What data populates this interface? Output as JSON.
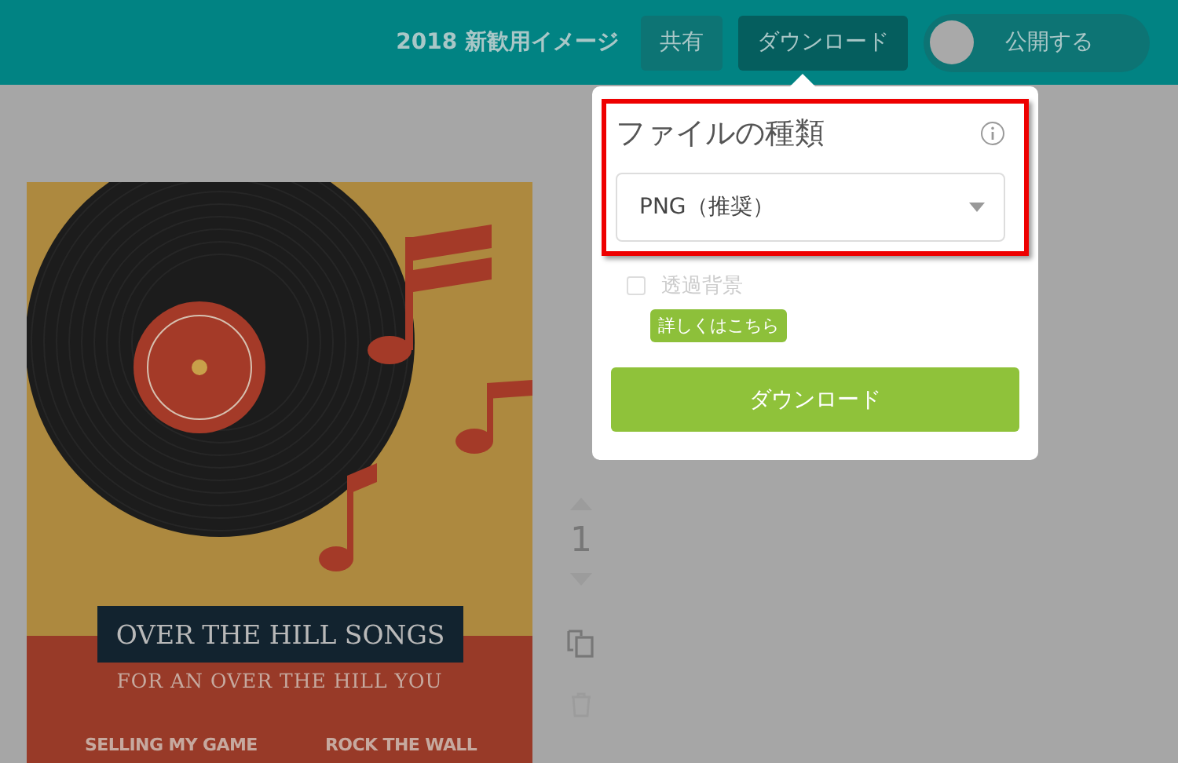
{
  "header": {
    "title": "2018 新歓用イメージ",
    "buttons": [
      {
        "label": "共有",
        "selected": false
      },
      {
        "label": "ダウンロード",
        "selected": true
      }
    ],
    "publish_toggle": {
      "label": "公開する",
      "on": false
    }
  },
  "download_panel": {
    "heading": "ファイルの種類",
    "highlighted": true,
    "file_type": {
      "value": "PNG（推奨）"
    },
    "transparent_background": {
      "label": "透過背景",
      "checked": false,
      "disabled": true
    },
    "help_badge": "詳しくはこちら",
    "download_button": "ダウンロード"
  },
  "poster": {
    "title": "OVER THE HILL SONGS",
    "subtitle": "FOR AN OVER THE HILL YOU",
    "songs": [
      "SELLING MY GAME",
      "ROCK THE WALL"
    ]
  },
  "page_controls": {
    "page_number": "1"
  }
}
